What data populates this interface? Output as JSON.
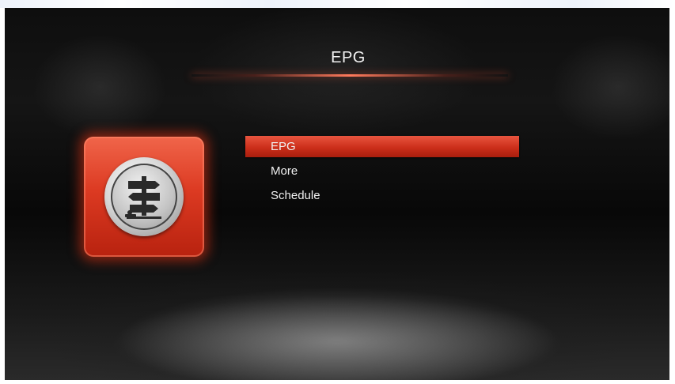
{
  "screen": {
    "title": "EPG"
  },
  "tile": {
    "icon": "signpost-icon"
  },
  "menu": {
    "items": [
      {
        "label": "EPG",
        "selected": true
      },
      {
        "label": "More",
        "selected": false
      },
      {
        "label": "Schedule",
        "selected": false
      }
    ]
  },
  "colors": {
    "accent": "#d8341f",
    "tile_glow": "#dc3214",
    "text": "#f0f0f0",
    "background": "#0e0e0e"
  }
}
